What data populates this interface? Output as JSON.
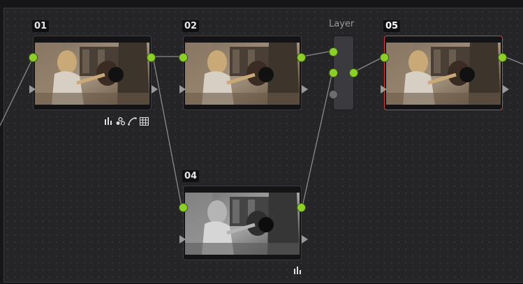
{
  "nodes": [
    {
      "id": "01",
      "label": "01"
    },
    {
      "id": "02",
      "label": "02"
    },
    {
      "id": "04",
      "label": "04"
    },
    {
      "id": "05",
      "label": "05"
    }
  ],
  "layer_mixer": {
    "label": "Layer"
  },
  "colors": {
    "port_active": "#8ccf2a",
    "port_inactive": "#6d6d6d",
    "selected_border": "#c44a44",
    "wire": "#8a8a8a"
  },
  "icons": {
    "node_01": [
      "scopes-icon",
      "color-warp-icon",
      "curves-icon",
      "grid-icon"
    ],
    "node_04": [
      "scopes-icon"
    ]
  }
}
